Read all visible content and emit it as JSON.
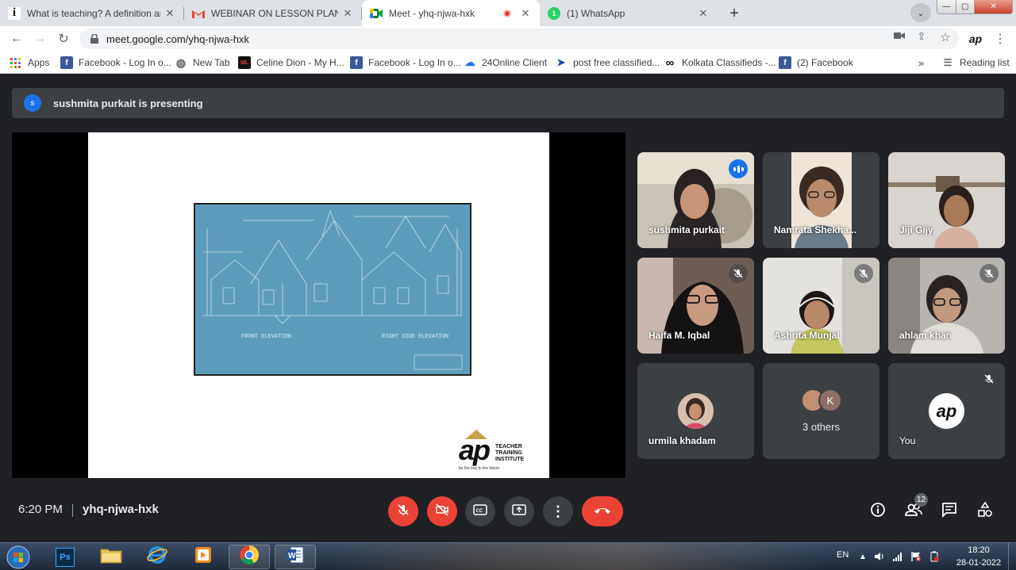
{
  "tabs": [
    {
      "title": "What is teaching? A definition and",
      "favicon": "i"
    },
    {
      "title": "WEBINAR ON LESSON PLAN ON",
      "favicon": "M"
    },
    {
      "title": "Meet - yhq-njwa-hxk",
      "favicon": "meet"
    },
    {
      "title": "(1) WhatsApp",
      "favicon": "1"
    }
  ],
  "address_bar": {
    "url": "meet.google.com/yhq-njwa-hxk"
  },
  "profile_initials": "ap",
  "bookmarks": [
    {
      "label": "Apps",
      "icon": "apps-grid-icon"
    },
    {
      "label": "Facebook - Log In o...",
      "icon": "facebook-icon"
    },
    {
      "label": "New Tab",
      "icon": "globe-icon"
    },
    {
      "label": "Celine Dion - My H...",
      "icon": "ml-icon"
    },
    {
      "label": "Facebook - Log In o...",
      "icon": "facebook-icon"
    },
    {
      "label": "24Online Client",
      "icon": "cloud-icon"
    },
    {
      "label": "post free classified...",
      "icon": "arrow-icon"
    },
    {
      "label": "Kolkata Classifieds -...",
      "icon": "infinity-icon"
    },
    {
      "label": "(2) Facebook",
      "icon": "facebook-icon"
    }
  ],
  "bookmarks_more": "»",
  "reading_list": "Reading list",
  "meet": {
    "presenter_initial": "s",
    "presenting_text": "sushmita purkait is presenting",
    "slide": {
      "logo_main": "ap",
      "logo_line1": "TEACHER",
      "logo_line2": "TRAINING",
      "logo_line3": "INSTITUTE",
      "logo_tagline": "be the key to the future",
      "blueprint_label_left": "FRONT ELEVATION",
      "blueprint_label_right": "RIGHT SIDE ELEVATION"
    },
    "participants": [
      {
        "name": "sushmita purkait",
        "state": "speaking"
      },
      {
        "name": "Namrata Shekha...",
        "state": "normal"
      },
      {
        "name": "Jiji Gijy",
        "state": "normal"
      },
      {
        "name": "Haifa M. Iqbal",
        "state": "muted"
      },
      {
        "name": "Ashrita Munjal",
        "state": "muted"
      },
      {
        "name": "ahlam khan",
        "state": "muted"
      },
      {
        "name": "urmila khadam",
        "state": "avatar"
      },
      {
        "name": "3 others",
        "state": "group",
        "avatar_letter": "K"
      },
      {
        "name": "You",
        "state": "muted-self",
        "avatar_text": "ap"
      }
    ],
    "bottom": {
      "time": "6:20 PM",
      "meeting_code": "yhq-njwa-hxk",
      "people_count": "12"
    }
  },
  "taskbar": {
    "language": "EN",
    "time": "18:20",
    "date": "28-01-2022"
  },
  "colors": {
    "meet_bg": "#202124",
    "tile_bg": "#3c4043",
    "danger": "#ea4335",
    "accent": "#1a73e8"
  }
}
